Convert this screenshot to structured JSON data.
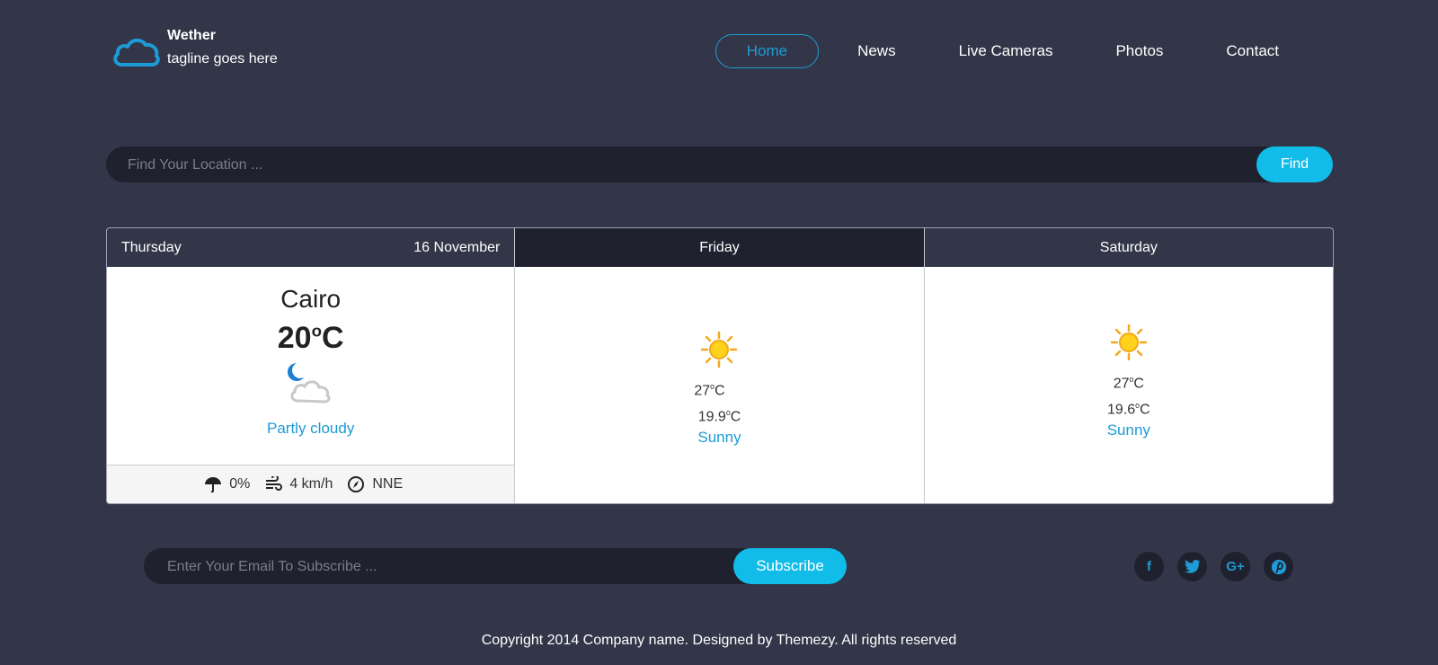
{
  "brand": {
    "name": "Wether",
    "tagline": "tagline goes here",
    "accent": "#1d9bd6"
  },
  "nav": {
    "items": [
      {
        "label": "Home",
        "active": true
      },
      {
        "label": "News"
      },
      {
        "label": "Live Cameras"
      },
      {
        "label": "Photos"
      },
      {
        "label": "Contact"
      }
    ]
  },
  "search": {
    "placeholder": "Find Your Location ...",
    "button": "Find"
  },
  "forecast": {
    "today": {
      "day": "Thursday",
      "date": "16 November",
      "city": "Cairo",
      "temp": "20",
      "unit": "C",
      "condition": "Partly cloudy",
      "icon": "moon-cloud-icon",
      "rain": "0%",
      "wind": "4 km/h",
      "direction": "NNE"
    },
    "days": [
      {
        "day": "Friday",
        "high": "27",
        "low": "19.9",
        "unit": "C",
        "condition": "Sunny",
        "icon": "sun-icon"
      },
      {
        "day": "Saturday",
        "high": "27",
        "low": "19.6",
        "unit": "C",
        "condition": "Sunny",
        "icon": "sun-icon"
      }
    ]
  },
  "subscribe": {
    "placeholder": "Enter Your Email To Subscribe ...",
    "button": "Subscribe"
  },
  "socials": {
    "facebook": "f",
    "google": "G+",
    "icons": [
      "facebook-icon",
      "twitter-icon",
      "google-plus-icon",
      "pinterest-icon"
    ]
  },
  "footer": {
    "copyright": "Copyright 2014 Company name. Designed by Themezy. All rights reserved"
  },
  "colors": {
    "background": "#323648",
    "dark": "#1f212e",
    "button": "#11bce8",
    "accent": "#1d9bd6"
  }
}
